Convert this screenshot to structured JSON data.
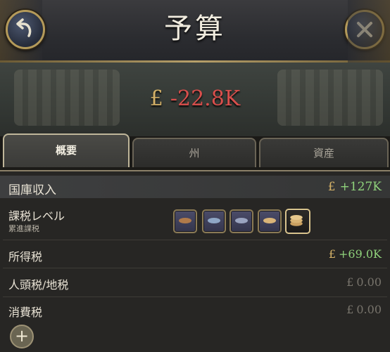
{
  "header": {
    "title": "予算",
    "back_icon": "back-arrow-icon",
    "close_icon": "close-icon"
  },
  "summary": {
    "currency_symbol": "£",
    "balance": "-22.8K",
    "balance_color": "#d94f4c"
  },
  "tabs": [
    {
      "label": "概要",
      "active": true
    },
    {
      "label": "州",
      "active": false
    },
    {
      "label": "資産",
      "active": false
    }
  ],
  "treasury": {
    "label": "国庫収入",
    "currency_symbol": "£",
    "value": "+127K"
  },
  "tax_level": {
    "label": "課税レベル",
    "sub_label": "累進課税",
    "levels": [
      "cake-icon-1",
      "cake-icon-2",
      "cake-icon-3",
      "cake-icon-4",
      "coin-stack-icon"
    ],
    "selected_index": 4
  },
  "rows": [
    {
      "label": "所得税",
      "currency_symbol": "£",
      "value": "+69.0K"
    },
    {
      "label": "人頭税/地税",
      "currency_symbol": "£",
      "value": "0.00"
    },
    {
      "label": "消費税",
      "currency_symbol": "£",
      "value": "0.00"
    }
  ],
  "add_button": "+"
}
